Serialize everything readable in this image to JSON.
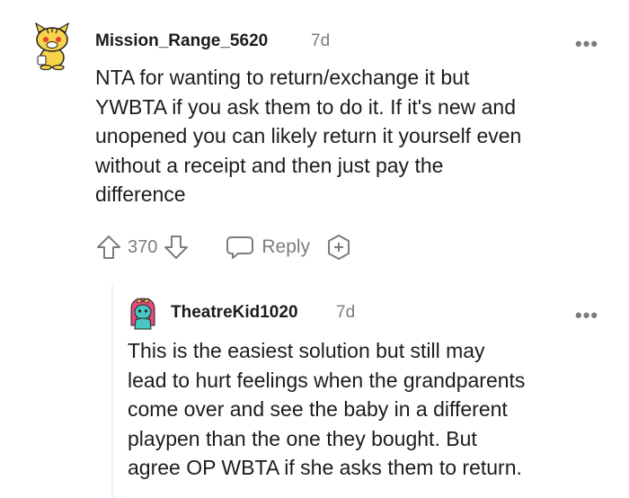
{
  "comments": [
    {
      "username": "Mission_Range_5620",
      "age": "7d",
      "body_lines": [
        "NTA for wanting to return/exchange it but",
        "YWBTA if you ask them to do it. If it's new and",
        "unopened you can likely return it yourself even",
        "without a receipt and then just pay the",
        "difference"
      ],
      "votes": "370",
      "reply_label": "Reply",
      "more_label": "•••",
      "avatar_icon": "snoo-avatar-yellow-icon"
    },
    {
      "username": "TheatreKid1020",
      "age": "7d",
      "body_lines": [
        "This is the easiest solution but still may",
        "lead to hurt feelings when the grandparents",
        "come over and see the baby in a different",
        "playpen than the one they bought. But",
        "agree OP WBTA if she asks them to return."
      ],
      "more_label": "•••",
      "avatar_icon": "snoo-avatar-pink-icon"
    }
  ],
  "colors": {
    "text": "#1c1c1c",
    "muted": "#7c7c7c",
    "thread": "#edeff1"
  }
}
